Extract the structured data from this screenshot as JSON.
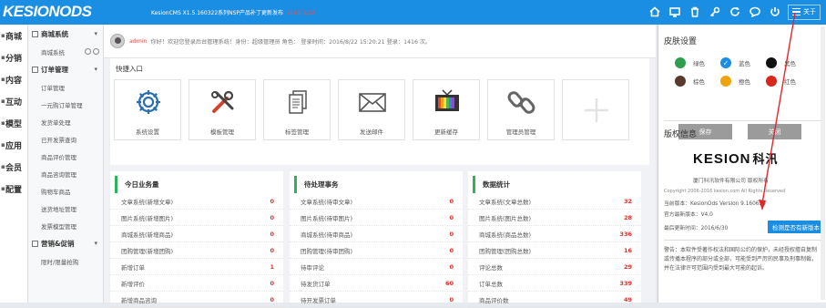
{
  "header": {
    "logo": "KESIONODS",
    "info": "KesionCMS X1.5.160322系列NSP产品补丁更新发布",
    "update_badge": "2016/3/22",
    "settings_label": "关于"
  },
  "left_nav": [
    {
      "label": "商城"
    },
    {
      "label": "分销"
    },
    {
      "label": "内容"
    },
    {
      "label": "互动"
    },
    {
      "label": "模型"
    },
    {
      "label": "应用"
    },
    {
      "label": "会员"
    },
    {
      "label": "配置"
    }
  ],
  "sub_nav": {
    "section1": {
      "title": "商城系统",
      "items": [
        "商城系统"
      ]
    },
    "section2": {
      "title": "订单管理",
      "items": [
        "订单管理",
        "一元购订单管理",
        "发货单处理",
        "已开发票查询",
        "商品评价管理",
        "商品咨询管理",
        "购物车商品",
        "送货地址管理",
        "发票模型管理"
      ]
    },
    "section3": {
      "title": "营销&促销",
      "items": [
        "限时/限量抢购"
      ]
    }
  },
  "welcome": {
    "user": "admin",
    "text": "你好！欢迎您登录后台管理系统！身份：超级管理员 角色： 登录时间：2016/8/22 15:20:21 登录：1416 次。"
  },
  "quick_entry": {
    "title": "快捷入口",
    "items": [
      {
        "label": "系统设置",
        "icon": "gear-icon"
      },
      {
        "label": "模板管理",
        "icon": "tools-icon"
      },
      {
        "label": "标签管理",
        "icon": "document-icon"
      },
      {
        "label": "发送邮件",
        "icon": "envelope-icon"
      },
      {
        "label": "更新缓存",
        "icon": "tv-icon"
      },
      {
        "label": "管理员管理",
        "icon": "chain-icon"
      },
      {
        "label": "",
        "icon": "plus-icon"
      }
    ]
  },
  "panels": {
    "today": {
      "title": "今日业务量",
      "rows": [
        {
          "label": "文章系统(新增文章)",
          "value": "0"
        },
        {
          "label": "图片系统(新增图片)",
          "value": "0"
        },
        {
          "label": "商城系统(新增商品)",
          "value": "0"
        },
        {
          "label": "团购管理(新增团购)",
          "value": "0"
        },
        {
          "label": "新增订单",
          "value": "1"
        },
        {
          "label": "新增评价",
          "value": "0"
        },
        {
          "label": "新增商品咨询",
          "value": "0"
        }
      ]
    },
    "pending": {
      "title": "待处理事务",
      "rows": [
        {
          "label": "文章系统(待审文章)",
          "value": "0"
        },
        {
          "label": "图片系统(待审图片)",
          "value": "0"
        },
        {
          "label": "商城系统(待审商品)",
          "value": "0"
        },
        {
          "label": "团购管理(待审团购)",
          "value": "0"
        },
        {
          "label": "待审评论",
          "value": "0"
        },
        {
          "label": "待发货订单",
          "value": "60"
        },
        {
          "label": "待开发票订单",
          "value": "0"
        }
      ]
    },
    "stats": {
      "title": "数据统计",
      "rows": [
        {
          "label": "文章系统(文章总数)",
          "value": "32"
        },
        {
          "label": "图片系统(图片总数)",
          "value": "28"
        },
        {
          "label": "商城系统(商品总数)",
          "value": "336"
        },
        {
          "label": "团购管理(团购总数)",
          "value": "16"
        },
        {
          "label": "评论总数",
          "value": "29"
        },
        {
          "label": "订单总数",
          "value": "339"
        },
        {
          "label": "商品评价数",
          "value": "49"
        }
      ]
    }
  },
  "right_panel": {
    "skin_title": "皮肤设置",
    "swatches": [
      {
        "label": "绿色",
        "color": "#2e9e4f"
      },
      {
        "label": "蓝色",
        "color": "#1a8ee3",
        "selected": true
      },
      {
        "label": "黑色",
        "color": "#111111"
      },
      {
        "label": "棕色",
        "color": "#5a3a2e"
      },
      {
        "label": "橙色",
        "color": "#f0a30a"
      },
      {
        "label": "红色",
        "color": "#d9251c"
      }
    ],
    "btn_ok": "保存",
    "btn_close": "关闭",
    "copyright_title": "版权信息",
    "brand": "KESION",
    "brand_cn": "科汛",
    "company": "厦门科汛软件有限公司 版权所有",
    "copyright_line": "Copyright 2006-2016 kesion.com All Rights Reserved",
    "version_line": "当前版本：KesionOds Version 9.160630",
    "official_line": "官方最新版本：V4.0",
    "last_update_label": "最后更新时间：2016/6/30",
    "check_btn": "检测是否有新版本",
    "legal_text": "警告：本软件受著作权法和国际公约的保护，未经授权擅自复制或传播本程序的部分或全部，可能受到严厉的民事及刑事制裁，并在法律许可范围内受到最大可能的起诉。"
  }
}
